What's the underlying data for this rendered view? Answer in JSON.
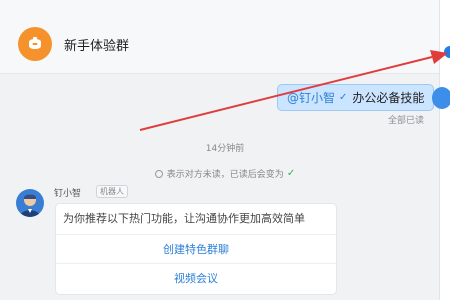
{
  "header": {
    "title": "新手体验群"
  },
  "messages": {
    "sent": {
      "mention": "@钉小智",
      "text": "办公必备技能",
      "read_status": "全部已读"
    },
    "timestamp": "14分钟前",
    "read_legend": {
      "text": "表示对方未读，已读后会变为"
    },
    "bot": {
      "name": "钉小智",
      "badge": "机器人",
      "card": {
        "message": "为你推荐以下热门功能，让沟通协作更加高效简单",
        "buttons": [
          {
            "label": "创建特色群聊"
          },
          {
            "label": "视频会议"
          }
        ]
      }
    }
  },
  "icons": {
    "group_avatar": "group-avatar-icon",
    "read_check": "check-icon",
    "unread_ring": "unread-circle-icon",
    "annotation_arrow": "red-arrow"
  },
  "colors": {
    "accent": "#2b7fd8",
    "bubble": "#cbe4ff",
    "group_avatar": "#f6922b",
    "arrow": "#e03c3c"
  }
}
